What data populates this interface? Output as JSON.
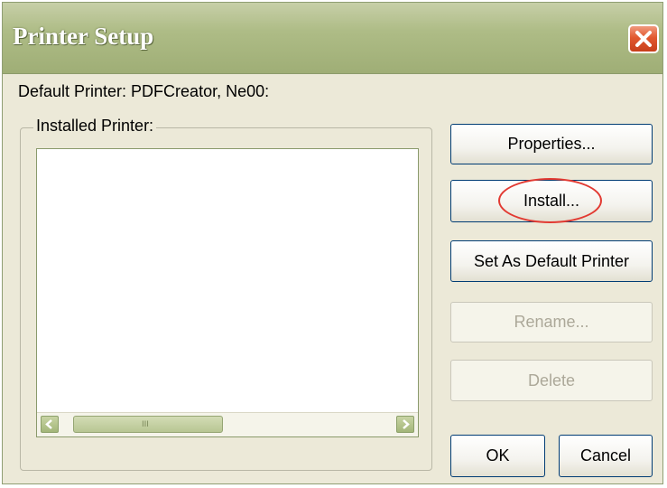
{
  "window": {
    "title": "Printer Setup",
    "close_icon": "close-icon"
  },
  "default_printer_text": "Default Printer: PDFCreator, Ne00:",
  "installed_group": {
    "label": "Installed Printer:",
    "printers": [],
    "scrollbar": {
      "left_icon": "chevron-left-icon",
      "right_icon": "chevron-right-icon",
      "grip_text": "III"
    }
  },
  "buttons": {
    "properties": "Properties...",
    "install": "Install...",
    "set_default": "Set As Default Printer",
    "rename": "Rename...",
    "delete": "Delete",
    "ok": "OK",
    "cancel": "Cancel"
  },
  "colors": {
    "titlebar": "#aebc86",
    "close_button": "#e2582f",
    "highlight_oval": "#e23a32",
    "dialog_bg": "#ece9d8"
  }
}
